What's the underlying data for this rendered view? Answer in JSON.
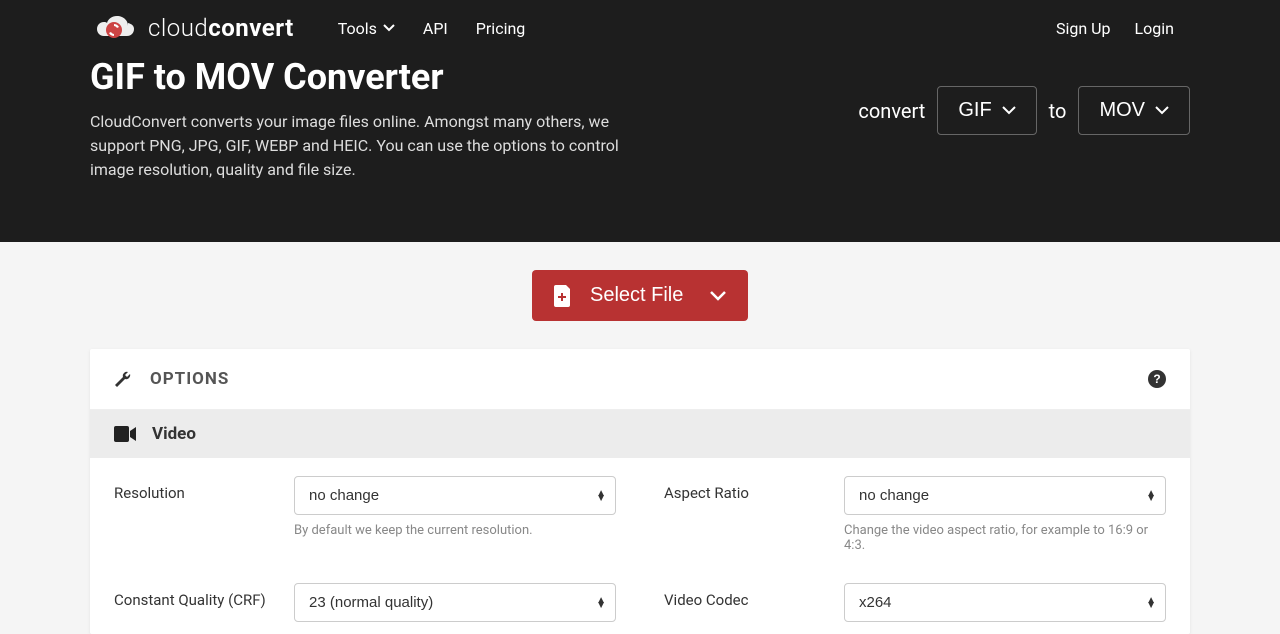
{
  "brand": {
    "name_light": "cloud",
    "name_bold": "convert"
  },
  "nav": {
    "tools": "Tools",
    "api": "API",
    "pricing": "Pricing",
    "signup": "Sign Up",
    "login": "Login"
  },
  "hero": {
    "title": "GIF to MOV Converter",
    "desc": "CloudConvert converts your image files online. Amongst many others, we support PNG, JPG, GIF, WEBP and HEIC. You can use the options to control image resolution, quality and file size.",
    "convert_label": "convert",
    "from_format": "GIF",
    "to_label": "to",
    "to_format": "MOV"
  },
  "select_file": {
    "label": "Select File"
  },
  "options_panel": {
    "title": "OPTIONS",
    "video_section": "Video",
    "resolution": {
      "label": "Resolution",
      "value": "no change",
      "help": "By default we keep the current resolution."
    },
    "aspect_ratio": {
      "label": "Aspect Ratio",
      "value": "no change",
      "help": "Change the video aspect ratio, for example to 16:9 or 4:3."
    },
    "crf": {
      "label": "Constant Quality (CRF)",
      "value": "23 (normal quality)"
    },
    "video_codec": {
      "label": "Video Codec",
      "value": "x264"
    }
  }
}
